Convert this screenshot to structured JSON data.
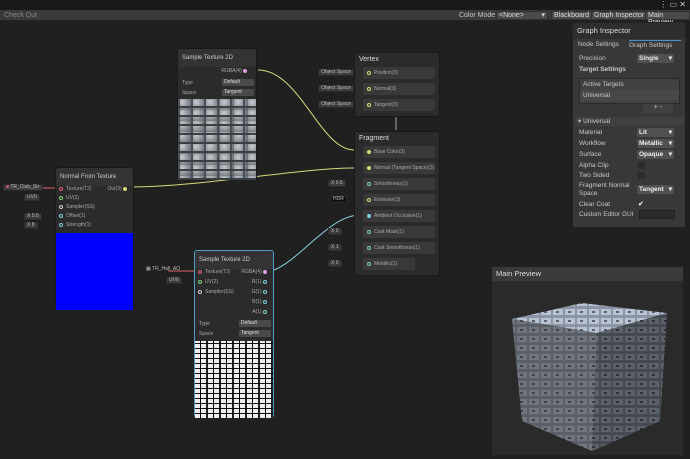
{
  "toolbar": {
    "check_out": "Check Out",
    "color_mode_label": "Color Mode",
    "color_mode_value": "<None>",
    "blackboard": "Blackboard",
    "graph_inspector": "Graph Inspector",
    "main_preview": "Main Preview"
  },
  "inspector": {
    "title": "Graph Inspector",
    "tabs": [
      "Node Settings",
      "Graph Settings"
    ],
    "precision_label": "Precision",
    "precision_value": "Single",
    "target_settings": "Target Settings",
    "active_targets": "Active Targets",
    "target_item": "Universal",
    "add": "+",
    "remove": "-",
    "section": "Universal",
    "rows": [
      {
        "label": "Material",
        "value": "Lit"
      },
      {
        "label": "Workflow",
        "value": "Metallic"
      },
      {
        "label": "Surface",
        "value": "Opaque"
      }
    ],
    "alpha_clip": "Alpha Clip",
    "two_sided": "Two Sided",
    "fns_label1": "Fragment Normal",
    "fns_label2": "Space",
    "fns_value": "Tangent",
    "clear_coat": "Clear Coat",
    "custom_editor": "Custom Editor GUI"
  },
  "sample1": {
    "title": "Sample Texture 2D",
    "out": "RGBA(4)",
    "type_label": "Type",
    "type_value": "Default",
    "space_label": "Space",
    "space_value": "Tangent"
  },
  "vertex": {
    "title": "Vertex",
    "ports": [
      {
        "in": "Object Space",
        "label": "Position(3)"
      },
      {
        "in": "Object Space",
        "label": "Normal(3)"
      },
      {
        "in": "Object Space",
        "label": "Tangent(3)"
      }
    ]
  },
  "fragment": {
    "title": "Fragment",
    "ports": [
      {
        "in": "",
        "label": "Base Color(3)"
      },
      {
        "in": "",
        "label": "Normal (Tangent Space)(3)"
      },
      {
        "in": "X  0.5",
        "label": "Smoothness(1)"
      },
      {
        "in": "HDR",
        "label": "Emission(3)"
      },
      {
        "in": "",
        "label": "Ambient Occlusion(1)"
      },
      {
        "in": "X  0",
        "label": "Coat Mask(1)"
      },
      {
        "in": "X  1",
        "label": "Coat Smoothness(1)"
      },
      {
        "in": "X  0",
        "label": "Metallic(1)"
      }
    ]
  },
  "normal": {
    "title": "Normal From Texture",
    "texture_in": "TR_Club_Str",
    "uv_in": "UV0",
    "offset_in": "X  0.5",
    "strength_in": "X  8",
    "inputs": [
      "Texture(T2)",
      "UV(2)",
      "Sampler(SS)",
      "Offset(1)",
      "Strength(1)"
    ],
    "out": "Out(3)"
  },
  "sample2": {
    "title": "Sample Texture 2D",
    "texture_in": "TR_Hall_AO",
    "uv_in": "UV0",
    "inputs": [
      "Texture(T2)",
      "UV(2)",
      "Sampler(SS)"
    ],
    "outputs": [
      "RGBA(4)",
      "R(1)",
      "G(1)",
      "B(1)",
      "A(1)"
    ],
    "type_label": "Type",
    "type_value": "Default",
    "space_label": "Space",
    "space_value": "Tangent"
  },
  "preview": {
    "title": "Main Preview"
  }
}
